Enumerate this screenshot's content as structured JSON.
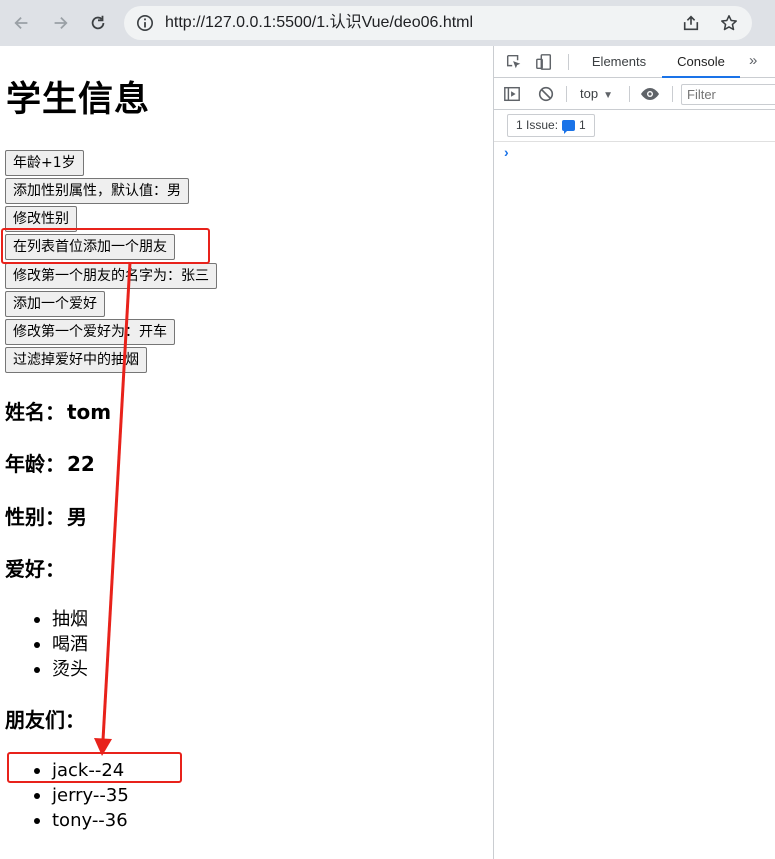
{
  "browser": {
    "url": "http://127.0.0.1:5500/1.认识Vue/deo06.html"
  },
  "page": {
    "title": "学生信息",
    "buttons": [
      "年龄+1岁",
      "添加性别属性，默认值：男",
      "修改性别",
      "在列表首位添加一个朋友",
      "修改第一个朋友的名字为：张三",
      "添加一个爱好",
      "修改第一个爱好为：开车",
      "过滤掉爱好中的抽烟"
    ],
    "name_label": "姓名：",
    "name_value": "tom",
    "age_label": "年龄：",
    "age_value": "22",
    "sex_label": "性别：",
    "sex_value": "男",
    "hobby_label": "爱好：",
    "hobbies": [
      "抽烟",
      "喝酒",
      "烫头"
    ],
    "friends_label": "朋友们：",
    "friends": [
      "jack--24",
      "jerry--35",
      "tony--36"
    ]
  },
  "annotation": {
    "color": "#e8221b"
  },
  "devtools": {
    "tabs": [
      "Elements",
      "Console"
    ],
    "active_tab": "Console",
    "context": "top",
    "filter_placeholder": "Filter",
    "issues_label": "1 Issue:",
    "issues_count": "1",
    "prompt_symbol": "›"
  }
}
